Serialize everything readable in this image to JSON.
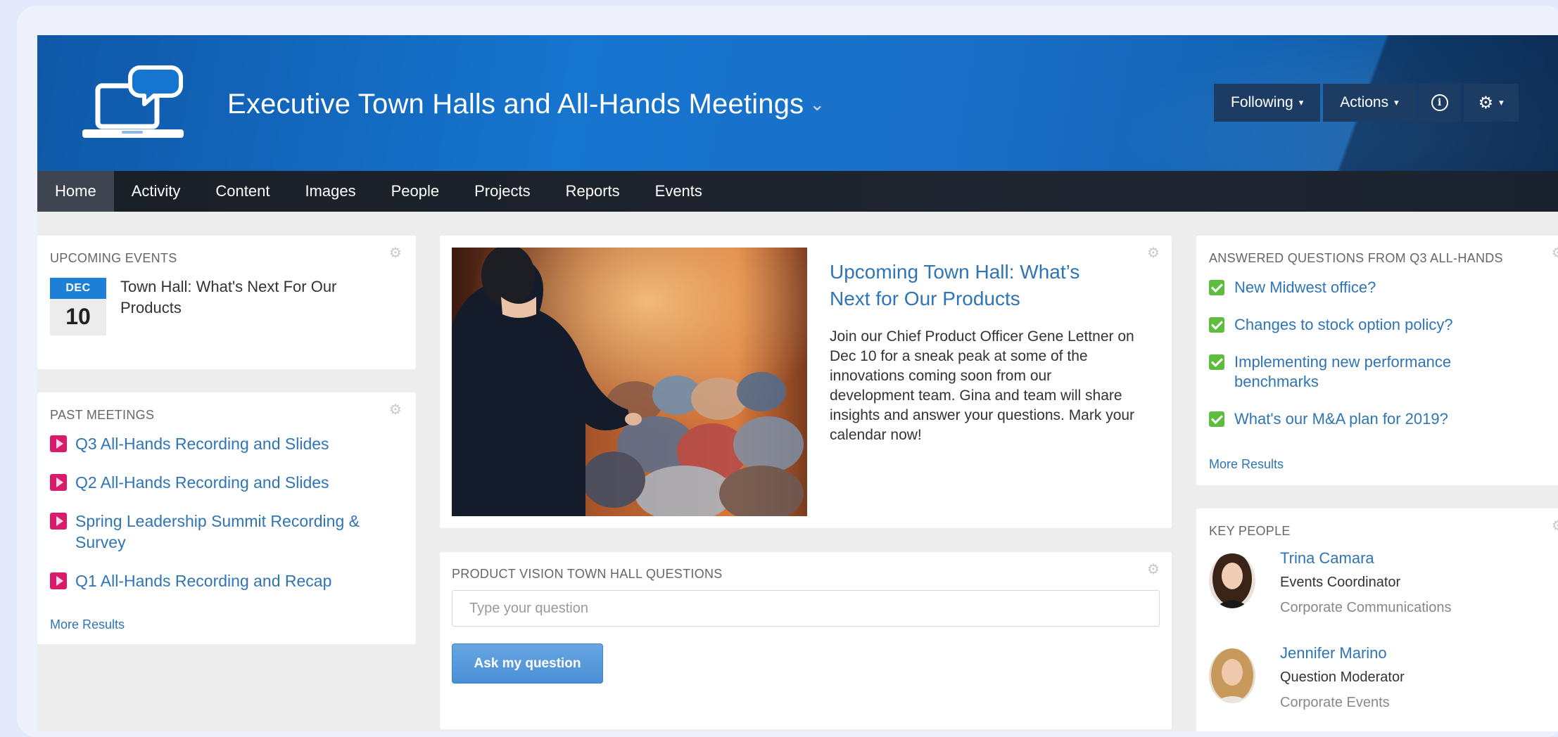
{
  "place": {
    "title": "Executive Town Halls and All-Hands Meetings",
    "title_caret": "⌄",
    "logo_icon": "laptop-chat-icon"
  },
  "header_actions": {
    "following": "Following",
    "actions": "Actions",
    "caret": "▾",
    "info_glyph": "i",
    "gear_glyph": "⚙"
  },
  "nav": {
    "items": [
      "Home",
      "Activity",
      "Content",
      "Images",
      "People",
      "Projects",
      "Reports",
      "Events"
    ],
    "active": "Home"
  },
  "upcoming_events": {
    "heading": "UPCOMING EVENTS",
    "event": {
      "month": "DEC",
      "day": "10",
      "title": "Town Hall: What's Next For Our Products"
    }
  },
  "past_meetings": {
    "heading": "PAST MEETINGS",
    "items": [
      "Q3 All-Hands Recording and Slides",
      "Q2 All-Hands Recording and Slides",
      "Spring Leadership Summit Recording & Survey",
      "Q1 All-Hands Recording and Recap"
    ],
    "more": "More Results"
  },
  "feature": {
    "title": "Upcoming Town Hall: What’s Next for Our Products",
    "body": "Join our Chief Product Officer Gene Lettner on Dec 10 for a sneak peak at some of the innovations coming soon from our development team. Gina and team will share insights and answer your questions. Mark your calendar now!"
  },
  "questions": {
    "heading": "PRODUCT VISION TOWN HALL QUESTIONS",
    "placeholder": "Type your question",
    "button": "Ask my question"
  },
  "answered": {
    "heading": "ANSWERED QUESTIONS FROM Q3 ALL-HANDS",
    "items": [
      "New Midwest office?",
      "Changes to stock option policy?",
      "Implementing new performance benchmarks",
      "What's our M&A plan for 2019?"
    ],
    "more": "More Results"
  },
  "key_people": {
    "heading": "KEY PEOPLE",
    "people": [
      {
        "name": "Trina Camara",
        "role": "Events Coordinator",
        "dept": "Corporate Communications"
      },
      {
        "name": "Jennifer Marino",
        "role": "Question Moderator",
        "dept": "Corporate Events"
      }
    ]
  },
  "colors": {
    "accent_link": "#2f74b5",
    "banner_blue": "#1675cf",
    "video_icon": "#d91b6b",
    "check_icon": "#5ebd3f",
    "date_month": "#1d7fd8"
  }
}
